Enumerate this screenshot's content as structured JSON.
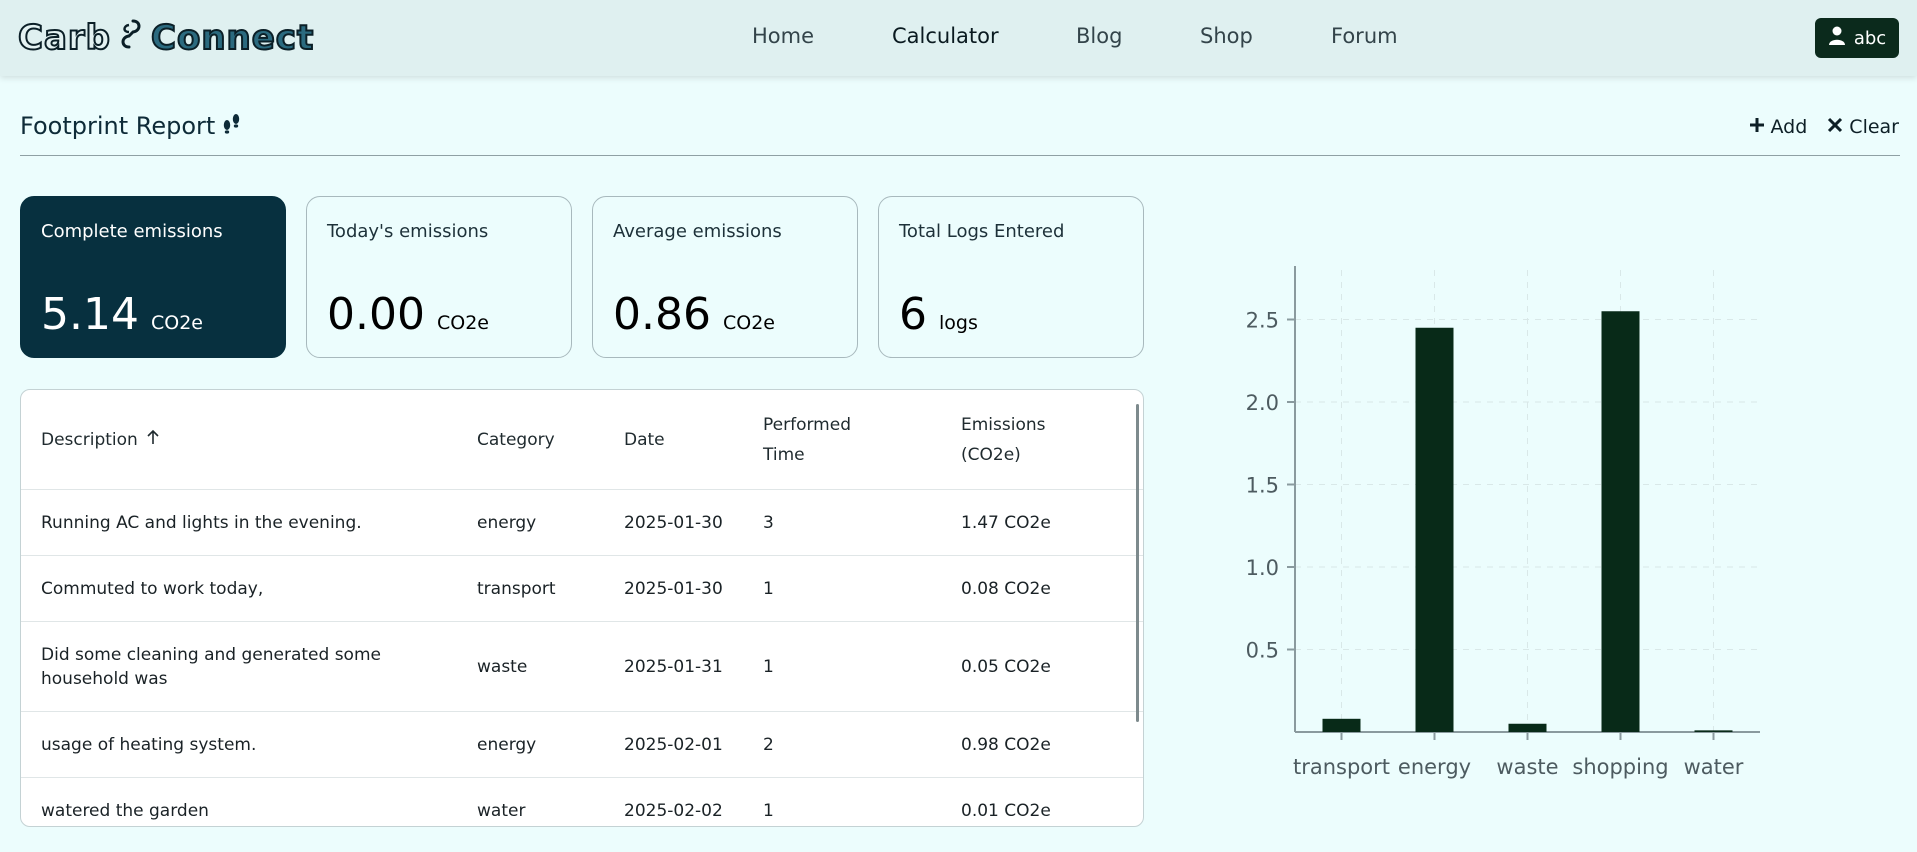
{
  "header": {
    "logo_part1": "Carb",
    "logo_part2": "Connect",
    "nav": [
      "Home",
      "Calculator",
      "Blog",
      "Shop",
      "Forum"
    ],
    "active_nav": "Calculator",
    "user_label": "abc"
  },
  "report": {
    "title": "Footprint Report",
    "add_label": "Add",
    "clear_label": "Clear"
  },
  "cards": [
    {
      "label": "Complete emissions",
      "value": "5.14",
      "unit": "CO2e"
    },
    {
      "label": "Today's emissions",
      "value": "0.00",
      "unit": "CO2e"
    },
    {
      "label": "Average emissions",
      "value": "0.86",
      "unit": "CO2e"
    },
    {
      "label": "Total Logs Entered",
      "value": "6",
      "unit": "logs"
    }
  ],
  "table": {
    "headers": {
      "description": "Description",
      "category": "Category",
      "date": "Date",
      "performed_1": "Performed",
      "performed_2": "Time",
      "emissions_1": "Emissions",
      "emissions_2": "(CO2e)"
    },
    "rows": [
      {
        "description": "Running AC and lights in the evening.",
        "category": "energy",
        "date": "2025-01-30",
        "performed": "3",
        "emissions": "1.47 CO2e"
      },
      {
        "description": "Commuted to work today,",
        "category": "transport",
        "date": "2025-01-30",
        "performed": "1",
        "emissions": "0.08 CO2e"
      },
      {
        "description": "Did some cleaning and generated some household was",
        "description_line1": "Did some cleaning and generated some",
        "description_line2": "household was",
        "category": "waste",
        "date": "2025-01-31",
        "performed": "1",
        "emissions": "0.05 CO2e"
      },
      {
        "description": "usage of heating system.",
        "category": "energy",
        "date": "2025-02-01",
        "performed": "2",
        "emissions": "0.98 CO2e"
      },
      {
        "description": "watered the garden",
        "category": "water",
        "date": "2025-02-02",
        "performed": "1",
        "emissions": "0.01 CO2e"
      }
    ]
  },
  "chart_data": {
    "type": "bar",
    "categories": [
      "transport",
      "energy",
      "waste",
      "shopping",
      "water"
    ],
    "values": [
      0.08,
      2.45,
      0.05,
      2.55,
      0.01
    ],
    "ylim": [
      0,
      2.8
    ],
    "yticks": [
      "0.5",
      "1.0",
      "1.5",
      "2.0",
      "2.5"
    ],
    "grid": true,
    "bar_color": "#082a18"
  }
}
